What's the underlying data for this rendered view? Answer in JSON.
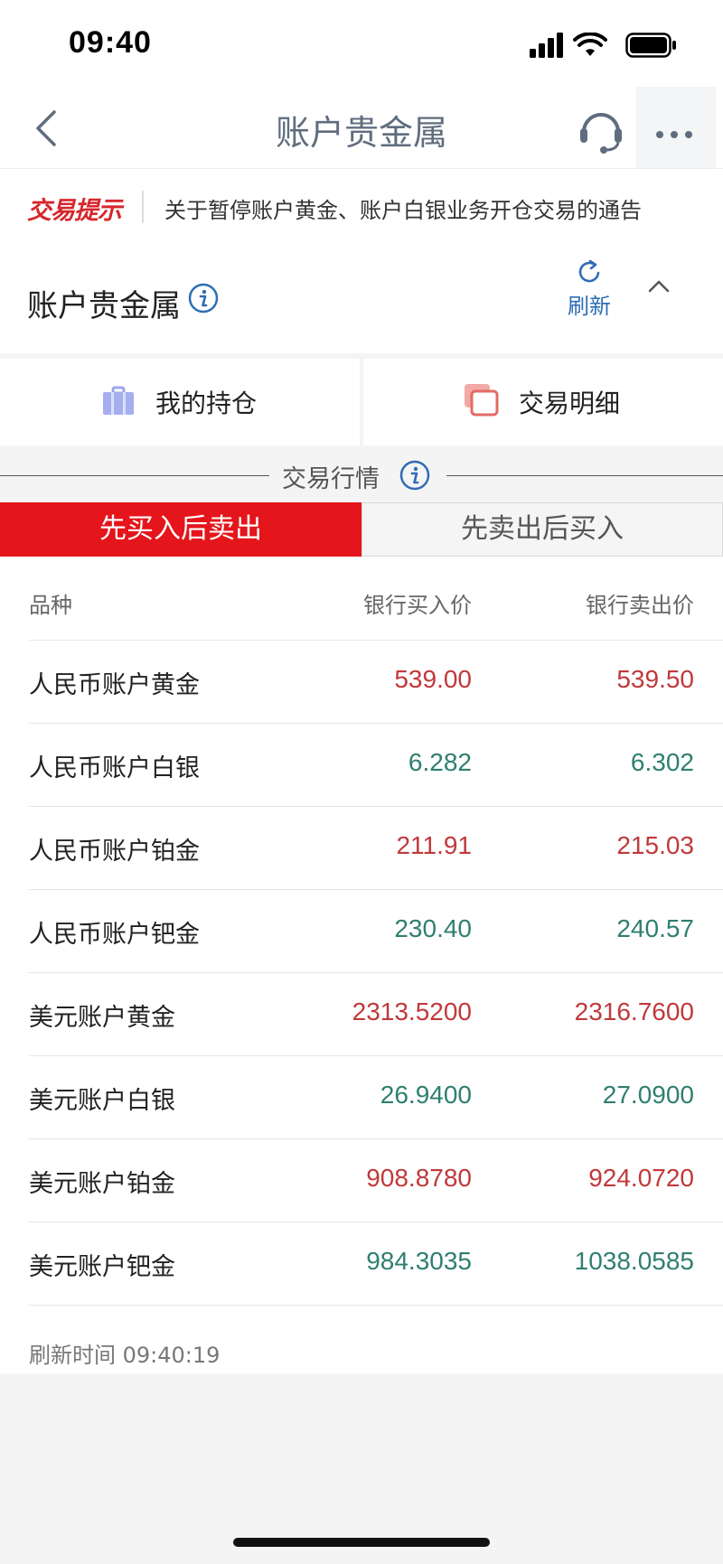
{
  "status_bar": {
    "time": "09:40"
  },
  "nav": {
    "title": "账户贵金属"
  },
  "notice": {
    "tag": "交易提示",
    "text": "关于暂停账户黄金、账户白银业务开仓交易的通告"
  },
  "section": {
    "title": "账户贵金属",
    "refresh_label": "刷新"
  },
  "quick_actions": {
    "holdings_label": "我的持仓",
    "details_label": "交易明细"
  },
  "market": {
    "title": "交易行情"
  },
  "tabs": {
    "buy_first": "先买入后卖出",
    "sell_first": "先卖出后买入"
  },
  "table": {
    "headers": {
      "name": "品种",
      "buy": "银行买入价",
      "sell": "银行卖出价"
    },
    "rows": [
      {
        "name": "人民币账户黄金",
        "buy": "539.00",
        "sell": "539.50",
        "trend": "up"
      },
      {
        "name": "人民币账户白银",
        "buy": "6.282",
        "sell": "6.302",
        "trend": "down"
      },
      {
        "name": "人民币账户铂金",
        "buy": "211.91",
        "sell": "215.03",
        "trend": "up"
      },
      {
        "name": "人民币账户钯金",
        "buy": "230.40",
        "sell": "240.57",
        "trend": "down"
      },
      {
        "name": "美元账户黄金",
        "buy": "2313.5200",
        "sell": "2316.7600",
        "trend": "up"
      },
      {
        "name": "美元账户白银",
        "buy": "26.9400",
        "sell": "27.0900",
        "trend": "down"
      },
      {
        "name": "美元账户铂金",
        "buy": "908.8780",
        "sell": "924.0720",
        "trend": "up"
      },
      {
        "name": "美元账户钯金",
        "buy": "984.3035",
        "sell": "1038.0585",
        "trend": "down"
      }
    ],
    "refresh_time": "刷新时间 09:40:19"
  },
  "colors": {
    "up": "#c0393b",
    "down": "#2f7f6f",
    "accent_red": "#e4151b",
    "accent_blue": "#2e6db5"
  },
  "icons": {
    "back": "chevron-left-icon",
    "service": "headset-icon",
    "more": "more-dots-icon",
    "info": "info-icon",
    "refresh": "refresh-icon",
    "collapse": "chevron-up-icon",
    "holdings": "briefcase-icon",
    "details": "copy-cards-icon"
  }
}
